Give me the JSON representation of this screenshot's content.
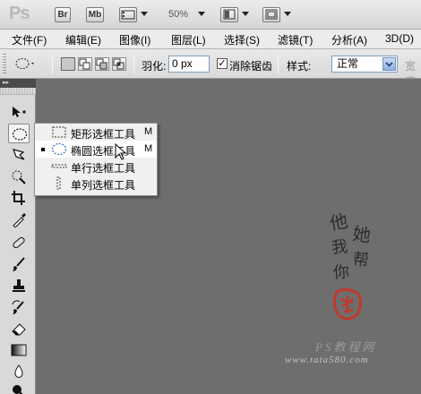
{
  "app": {
    "logo": "Ps",
    "bridge_label": "Br",
    "minibridge_label": "Mb",
    "zoom": "50%"
  },
  "menu": [
    {
      "label": "文件(F)"
    },
    {
      "label": "编辑(E)"
    },
    {
      "label": "图像(I)"
    },
    {
      "label": "图层(L)"
    },
    {
      "label": "选择(S)"
    },
    {
      "label": "滤镜(T)"
    },
    {
      "label": "分析(A)"
    },
    {
      "label": "3D(D)"
    }
  ],
  "options": {
    "feather_label": "羽化:",
    "feather_value": "0 px",
    "antialias_label": "消除锯齿",
    "antialias_checked": true,
    "style_label": "样式:",
    "style_value": "正常",
    "width_label": "宽度"
  },
  "flyout": {
    "items": [
      {
        "label": "矩形选框工具",
        "key": "M",
        "icon": "rect-marquee-icon",
        "selected": false
      },
      {
        "label": "椭圆选框工具",
        "key": "M",
        "icon": "ellipse-marquee-icon",
        "selected": true
      },
      {
        "label": "单行选框工具",
        "key": "",
        "icon": "single-row-marquee-icon",
        "selected": false
      },
      {
        "label": "单列选框工具",
        "key": "",
        "icon": "single-column-marquee-icon",
        "selected": false
      }
    ]
  },
  "watermark": {
    "calligraphy": [
      "他",
      "她",
      "我",
      "帮",
      "你"
    ],
    "name": "PS教程网",
    "site": "www.tata580.com",
    "seal_color": "#c0392b"
  },
  "colors": {
    "canvas": "#6e6e6e",
    "panel": "#d9d9d9",
    "accent": "#2f6fbf"
  }
}
